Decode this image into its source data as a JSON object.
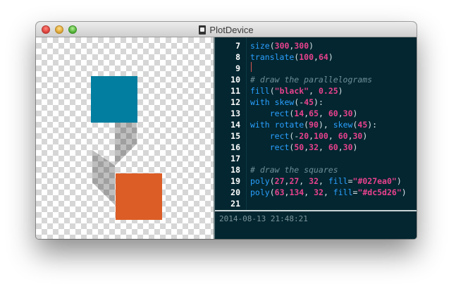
{
  "window": {
    "title": "PlotDevice"
  },
  "colors": {
    "square_blue": "#027ea0",
    "square_orange": "#dc5d26"
  },
  "editor": {
    "lines": [
      {
        "num": "7",
        "tokens": [
          [
            "kw",
            "size"
          ],
          [
            "pl",
            "("
          ],
          [
            "num",
            "300"
          ],
          [
            "pl",
            ","
          ],
          [
            "num",
            "300"
          ],
          [
            "pl",
            ")"
          ]
        ]
      },
      {
        "num": "8",
        "tokens": [
          [
            "kw",
            "translate"
          ],
          [
            "pl",
            "("
          ],
          [
            "num",
            "100"
          ],
          [
            "pl",
            ","
          ],
          [
            "num",
            "64"
          ],
          [
            "pl",
            ")"
          ]
        ]
      },
      {
        "num": "9",
        "tokens": []
      },
      {
        "num": "10",
        "tokens": [
          [
            "cm",
            "# draw the parallelograms"
          ]
        ]
      },
      {
        "num": "11",
        "tokens": [
          [
            "kw",
            "fill"
          ],
          [
            "pl",
            "("
          ],
          [
            "str",
            "\"black\""
          ],
          [
            "pl",
            ", "
          ],
          [
            "num",
            "0.25"
          ],
          [
            "pl",
            ")"
          ]
        ]
      },
      {
        "num": "12",
        "tokens": [
          [
            "kw",
            "with "
          ],
          [
            "kw",
            "skew"
          ],
          [
            "pl",
            "(-"
          ],
          [
            "num",
            "45"
          ],
          [
            "pl",
            "):"
          ]
        ]
      },
      {
        "num": "13",
        "tokens": [
          [
            "pl",
            "    "
          ],
          [
            "kw",
            "rect"
          ],
          [
            "pl",
            "("
          ],
          [
            "num",
            "14"
          ],
          [
            "pl",
            ","
          ],
          [
            "num",
            "65"
          ],
          [
            "pl",
            ", "
          ],
          [
            "num",
            "60"
          ],
          [
            "pl",
            ","
          ],
          [
            "num",
            "30"
          ],
          [
            "pl",
            ")"
          ]
        ]
      },
      {
        "num": "14",
        "tokens": [
          [
            "kw",
            "with "
          ],
          [
            "kw",
            "rotate"
          ],
          [
            "pl",
            "("
          ],
          [
            "num",
            "90"
          ],
          [
            "pl",
            "), "
          ],
          [
            "kw",
            "skew"
          ],
          [
            "pl",
            "("
          ],
          [
            "num",
            "45"
          ],
          [
            "pl",
            "):"
          ]
        ]
      },
      {
        "num": "15",
        "tokens": [
          [
            "pl",
            "    "
          ],
          [
            "kw",
            "rect"
          ],
          [
            "pl",
            "(-"
          ],
          [
            "num",
            "20"
          ],
          [
            "pl",
            ","
          ],
          [
            "num",
            "100"
          ],
          [
            "pl",
            ", "
          ],
          [
            "num",
            "60"
          ],
          [
            "pl",
            ","
          ],
          [
            "num",
            "30"
          ],
          [
            "pl",
            ")"
          ]
        ]
      },
      {
        "num": "16",
        "tokens": [
          [
            "pl",
            "    "
          ],
          [
            "kw",
            "rect"
          ],
          [
            "pl",
            "("
          ],
          [
            "num",
            "50"
          ],
          [
            "pl",
            ","
          ],
          [
            "num",
            "32"
          ],
          [
            "pl",
            ", "
          ],
          [
            "num",
            "60"
          ],
          [
            "pl",
            ","
          ],
          [
            "num",
            "30"
          ],
          [
            "pl",
            ")"
          ]
        ]
      },
      {
        "num": "17",
        "tokens": []
      },
      {
        "num": "18",
        "tokens": [
          [
            "cm",
            "# draw the squares"
          ]
        ]
      },
      {
        "num": "19",
        "tokens": [
          [
            "kw",
            "poly"
          ],
          [
            "pl",
            "("
          ],
          [
            "num",
            "27"
          ],
          [
            "pl",
            ","
          ],
          [
            "num",
            "27"
          ],
          [
            "pl",
            ", "
          ],
          [
            "num",
            "32"
          ],
          [
            "pl",
            ", "
          ],
          [
            "kw",
            "fill"
          ],
          [
            "pl",
            "="
          ],
          [
            "str",
            "\"#027ea0\""
          ],
          [
            "pl",
            ")"
          ]
        ]
      },
      {
        "num": "20",
        "tokens": [
          [
            "kw",
            "poly"
          ],
          [
            "pl",
            "("
          ],
          [
            "num",
            "63"
          ],
          [
            "pl",
            ","
          ],
          [
            "num",
            "134"
          ],
          [
            "pl",
            ", "
          ],
          [
            "num",
            "32"
          ],
          [
            "pl",
            ", "
          ],
          [
            "kw",
            "fill"
          ],
          [
            "pl",
            "="
          ],
          [
            "str",
            "\"#dc5d26\""
          ],
          [
            "pl",
            ")"
          ]
        ]
      },
      {
        "num": "21",
        "tokens": []
      }
    ]
  },
  "console": {
    "timestamp": "2014-08-13 21:48:21"
  }
}
